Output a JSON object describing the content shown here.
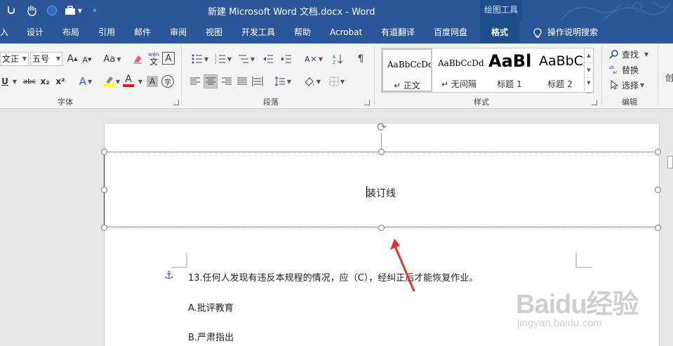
{
  "app": {
    "title": "新建 Microsoft Word 文档.docx  -  Word",
    "context_tab_header": "绘图工具"
  },
  "tabs": [
    "入",
    "设计",
    "布局",
    "引用",
    "邮件",
    "审阅",
    "视图",
    "开发工具",
    "帮助",
    "Acrobat",
    "有道翻译",
    "百度网盘",
    "格式"
  ],
  "active_tab": "格式",
  "tell_me": "操作说明搜索",
  "ribbon": {
    "font": {
      "label": "字体",
      "font_name": "文正",
      "font_size": "五号",
      "case_label": "Aa",
      "subscript_label": "x₂",
      "superscript_label": "x²",
      "strikethrough_label": "abc",
      "underline_label": "U",
      "phonetic_label": "wén",
      "border_char_label": "A",
      "shading_label": "A",
      "enclose_label": "字",
      "grow_label": "A",
      "shrink_label": "A",
      "effects_label": "A",
      "font_color_label": "A"
    },
    "paragraph": {
      "label": "段落"
    },
    "styles": {
      "label": "样式",
      "items": [
        {
          "preview": "AaBbCcDd",
          "name": "正文",
          "selected": true
        },
        {
          "preview": "AaBbCcDd",
          "name": "无间隔",
          "selected": false
        },
        {
          "preview": "AaBl",
          "name": "标题 1",
          "selected": false
        },
        {
          "preview": "AaBbC",
          "name": "标题 2",
          "selected": false
        }
      ]
    },
    "editing": {
      "label": "编辑",
      "find": "查找",
      "replace": "替换",
      "select": "选择"
    },
    "partial": "创"
  },
  "document": {
    "header_text": "装订线",
    "lines": [
      "13.任何人发现有违反本规程的情况，应（C），经纠正后才能恢复作业。",
      "A.批评教育",
      "B.严肃指出"
    ]
  },
  "watermark": {
    "logo": "Baidu经验",
    "url": "jingyan.baidu.com"
  },
  "colors": {
    "title_bar": "#2b579a",
    "active_tab": "#1e4e8c",
    "highlight": "#ffff00",
    "font_color": "#e81123",
    "arrow": "#e8322b"
  }
}
